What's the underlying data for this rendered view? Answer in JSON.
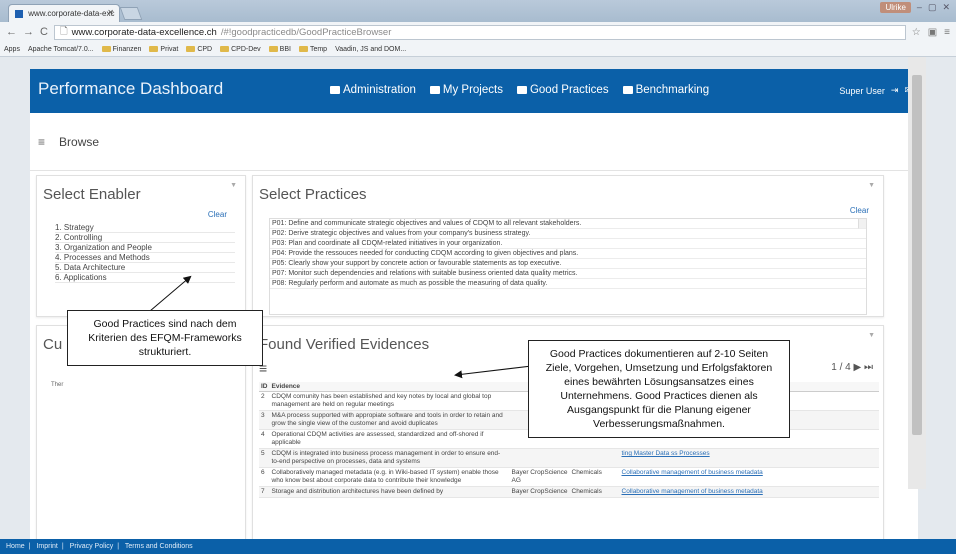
{
  "browser": {
    "tab_title": "www.corporate-data-exc",
    "url_host": "www.corporate-data-excellence.ch",
    "url_path": "/#!goodpracticedb/GoodPracticeBrowser",
    "user_chip": "Ulrike",
    "bookmarks": [
      "Apps",
      "Apache Tomcat/7.0...",
      "Finanzen",
      "Privat",
      "CPD",
      "CPD-Dev",
      "BBI",
      "Temp",
      "Vaadin, JS and DOM..."
    ]
  },
  "navbar": {
    "brand": "Performance Dashboard",
    "items": [
      "Administration",
      "My Projects",
      "Good Practices",
      "Benchmarking"
    ],
    "user": "Super User"
  },
  "browse": {
    "label": "Browse"
  },
  "enabler": {
    "title": "Select Enabler",
    "clear": "Clear",
    "items": [
      "1. Strategy",
      "2. Controlling",
      "3. Organization and People",
      "4. Processes and Methods",
      "5. Data Architecture",
      "6. Applications"
    ]
  },
  "practices": {
    "title": "Select Practices",
    "clear": "Clear",
    "items": [
      "P01: Define and communicate strategic objectives and values of CDQM to all relevant stakeholders.",
      "P02: Derive strategic objectives and values from your company's business strategy.",
      "P03: Plan and coordinate all CDQM-related initiatives in your organization.",
      "P04: Provide the ressouces needed for conducting CDQM according to given objectives and plans.",
      "P05: Clearly show your support by concrete action or favourable statements as top executive.",
      "P07: Monitor such dependencies and relations with suitable business oriented data quality metrics.",
      "P08: Regularly perform and automate as much as possible the measuring of data quality."
    ]
  },
  "current": {
    "title_fragment": "Cu",
    "text_fragment": "Ther"
  },
  "evidences": {
    "title": "Found Verified Evidences",
    "pager": "1 / 4",
    "headers": [
      "ID",
      "Evidence",
      "",
      "",
      ""
    ],
    "rows": [
      {
        "id": "2",
        "text": "CDQM comunity has been established and key notes by local and global top management are held on regular meetings",
        "company": "",
        "industry": "",
        "link": "ct Master Data"
      },
      {
        "id": "3",
        "text": "M&A process supported with appropiate software and tools in order to retain and grow the single view of the customer and avoid duplicates",
        "company": "",
        "industry": "",
        "link": "and acquisitions"
      },
      {
        "id": "4",
        "text": "Operational CDQM activities are assessed, standardized and off-shored if applicable",
        "company": "",
        "industry": "",
        "link": "ta"
      },
      {
        "id": "5",
        "text": "CDQM is integrated into business process management in order to ensure end-to-end perspective on processes, data and systems",
        "company": "",
        "industry": "",
        "link": "ting Master Data ss Processes"
      },
      {
        "id": "6",
        "text": "Collaboratively managed metadata (e.g. in Wiki-based IT system) enable those who know best about corporate data to contribute their knowledge",
        "company": "Bayer CropScience AG",
        "industry": "Chemicals",
        "link": "Collaborative management of business metadata"
      },
      {
        "id": "7",
        "text": "Storage and distribution architectures have been defined by",
        "company": "Bayer CropScience",
        "industry": "Chemicals",
        "link": "Collaborative management of business metadata"
      }
    ]
  },
  "callouts": {
    "left": "Good Practices sind nach dem Kriterien des EFQM-Frameworks strukturiert.",
    "right": "Good Practices dokumentieren auf 2-10 Seiten Ziele, Vorgehen, Umsetzung und Erfolgsfaktoren eines bewährten Lösungsansatzes eines Unternehmens. Good Practices dienen als Ausgangspunkt für die Planung eigener Verbesserungsmaßnahmen."
  },
  "footer": {
    "items": [
      "Home",
      "Imprint",
      "Privacy Policy",
      "Terms and Conditions"
    ]
  }
}
